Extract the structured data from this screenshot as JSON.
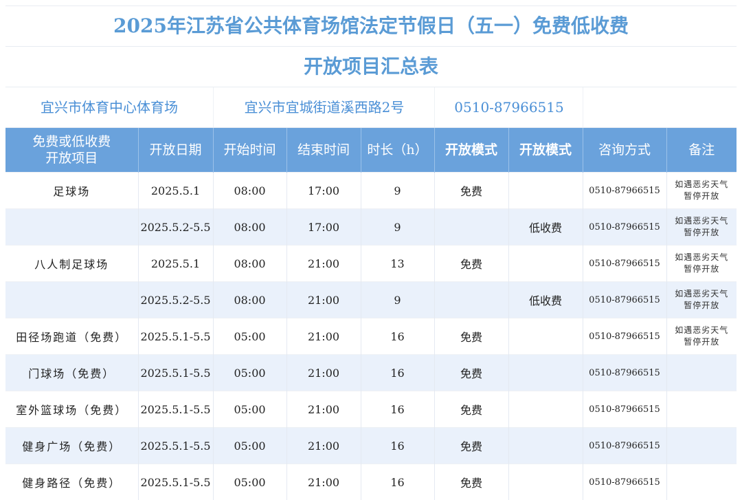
{
  "title_line1": "2025年江苏省公共体育场馆法定节假日（五一）免费低收费",
  "title_line2": "开放项目汇总表",
  "venue": {
    "name": "宜兴市体育中心体育场",
    "address": "宜兴市宜城街道溪西路2号",
    "phone": "0510-87966515"
  },
  "headers": {
    "project_line1": "免费或低收费",
    "project_line2": "开放项目",
    "date": "开放日期",
    "start": "开始时间",
    "end": "结束时间",
    "duration": "时长（h）",
    "mode_free": "开放模式",
    "mode_low": "开放模式",
    "contact": "咨询方式",
    "note": "备注"
  },
  "rows": [
    {
      "project": "足球场",
      "date": "2025.5.1",
      "start": "08:00",
      "end": "17:00",
      "duration": "9",
      "free": "免费",
      "low": "",
      "contact": "0510-87966515",
      "note_line1": "如遇恶劣天气",
      "note_line2": "暂停开放"
    },
    {
      "project": "",
      "date": "2025.5.2-5.5",
      "start": "08:00",
      "end": "17:00",
      "duration": "9",
      "free": "",
      "low": "低收费",
      "contact": "0510-87966515",
      "note_line1": "如遇恶劣天气",
      "note_line2": "暂停开放"
    },
    {
      "project": "八人制足球场",
      "date": "2025.5.1",
      "start": "08:00",
      "end": "21:00",
      "duration": "13",
      "free": "免费",
      "low": "",
      "contact": "0510-87966515",
      "note_line1": "如遇恶劣天气",
      "note_line2": "暂停开放"
    },
    {
      "project": "",
      "date": "2025.5.2-5.5",
      "start": "08:00",
      "end": "21:00",
      "duration": "9",
      "free": "",
      "low": "低收费",
      "contact": "0510-87966515",
      "note_line1": "如遇恶劣天气",
      "note_line2": "暂停开放"
    },
    {
      "project": "田径场跑道（免费）",
      "date": "2025.5.1-5.5",
      "start": "05:00",
      "end": "21:00",
      "duration": "16",
      "free": "免费",
      "low": "",
      "contact": "0510-87966515",
      "note_line1": "如遇恶劣天气",
      "note_line2": "暂停开放"
    },
    {
      "project": "门球场（免费）",
      "date": "2025.5.1-5.5",
      "start": "05:00",
      "end": "21:00",
      "duration": "16",
      "free": "免费",
      "low": "",
      "contact": "0510-87966515",
      "note_line1": "",
      "note_line2": ""
    },
    {
      "project": "室外篮球场（免费）",
      "date": "2025.5.1-5.5",
      "start": "05:00",
      "end": "21:00",
      "duration": "16",
      "free": "免费",
      "low": "",
      "contact": "0510-87966515",
      "note_line1": "",
      "note_line2": ""
    },
    {
      "project": "健身广场（免费）",
      "date": "2025.5.1-5.5",
      "start": "05:00",
      "end": "21:00",
      "duration": "16",
      "free": "免费",
      "low": "",
      "contact": "0510-87966515",
      "note_line1": "",
      "note_line2": ""
    },
    {
      "project": "健身路径（免费）",
      "date": "2025.5.1-5.5",
      "start": "05:00",
      "end": "21:00",
      "duration": "16",
      "free": "免费",
      "low": "",
      "contact": "0510-87966515",
      "note_line1": "",
      "note_line2": ""
    }
  ],
  "colors": {
    "title": "#5a9bd5",
    "header_bg": "#6aa2dc",
    "alt_row": "#eaf1fb"
  }
}
